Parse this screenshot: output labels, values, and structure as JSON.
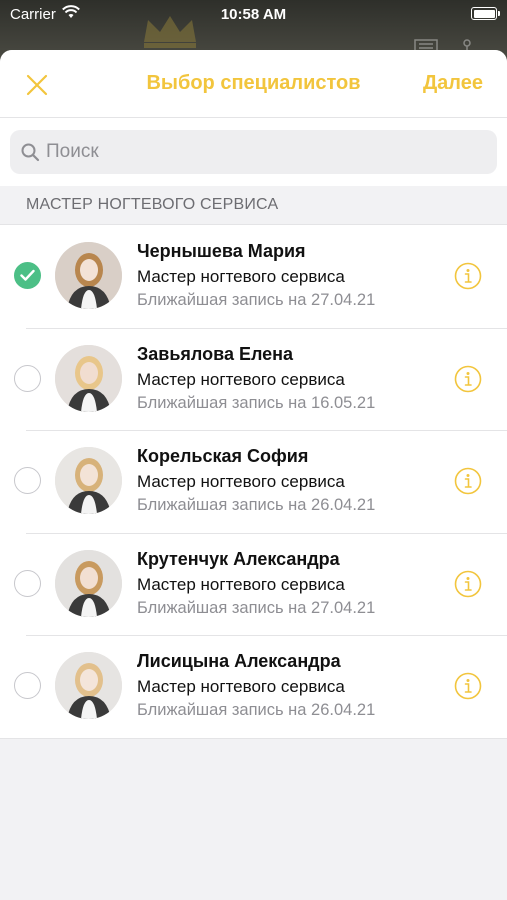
{
  "status_bar": {
    "carrier": "Carrier",
    "time": "10:58 AM"
  },
  "nav": {
    "title": "Выбор специалистов",
    "next_label": "Далее"
  },
  "search": {
    "placeholder": "Поиск"
  },
  "section": {
    "header": "МАСТЕР НОГТЕВОГО СЕРВИСА"
  },
  "specialists": [
    {
      "name": "Чернышева Мария",
      "role": "Мастер ногтевого сервиса",
      "next": "Ближайшая запись на 27.04.21",
      "selected": true
    },
    {
      "name": "Завьялова Елена",
      "role": "Мастер ногтевого сервиса",
      "next": "Ближайшая запись на 16.05.21",
      "selected": false
    },
    {
      "name": "Корельская София",
      "role": "Мастер ногтевого сервиса",
      "next": "Ближайшая запись на 26.04.21",
      "selected": false
    },
    {
      "name": "Крутенчук Александра",
      "role": "Мастер ногтевого сервиса",
      "next": "Ближайшая запись на 27.04.21",
      "selected": false
    },
    {
      "name": "Лисицына Александра",
      "role": "Мастер ногтевого сервиса",
      "next": "Ближайшая запись на 26.04.21",
      "selected": false
    }
  ],
  "colors": {
    "accent": "#f2c53d",
    "selected": "#4cbf86"
  },
  "icons": [
    "wifi-icon",
    "battery-icon",
    "close-icon",
    "search-icon",
    "checkmark-icon",
    "info-icon"
  ]
}
